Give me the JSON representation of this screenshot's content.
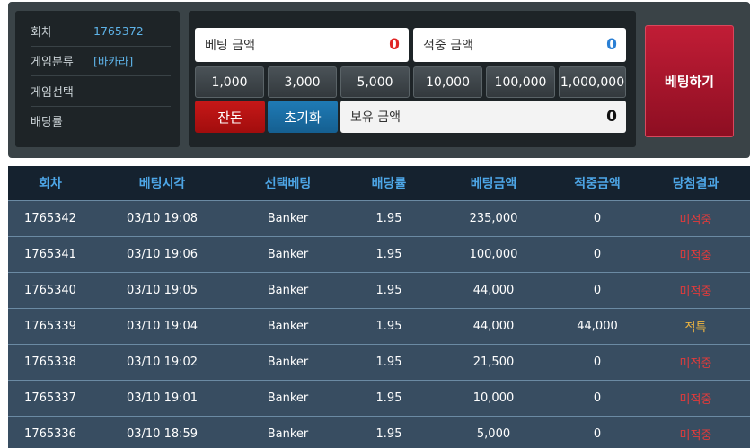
{
  "info": {
    "round_label": "회차",
    "round_value": "1765372",
    "category_label": "게임분류",
    "category_value": "[바카라]",
    "selection_label": "게임선택",
    "selection_value": "",
    "odds_label": "배당률",
    "odds_value": ""
  },
  "bet": {
    "amount_label": "베팅 금액",
    "amount_value": "0",
    "win_label": "적중 금액",
    "win_value": "0",
    "chips": [
      "1,000",
      "3,000",
      "5,000",
      "10,000",
      "100,000",
      "1,000,000"
    ],
    "allin_label": "잔돈",
    "reset_label": "초기화",
    "balance_label": "보유 금액",
    "balance_value": "0",
    "submit_label": "베팅하기"
  },
  "history": {
    "columns": [
      "회차",
      "베팅시각",
      "선택베팅",
      "배당률",
      "베팅금액",
      "적중금액",
      "당첨결과"
    ],
    "rows": [
      {
        "round": "1765342",
        "time": "03/10 19:08",
        "pick": "Banker",
        "odds": "1.95",
        "bet": "235,000",
        "win": "0",
        "result": "미적중",
        "hit": false
      },
      {
        "round": "1765341",
        "time": "03/10 19:06",
        "pick": "Banker",
        "odds": "1.95",
        "bet": "100,000",
        "win": "0",
        "result": "미적중",
        "hit": false
      },
      {
        "round": "1765340",
        "time": "03/10 19:05",
        "pick": "Banker",
        "odds": "1.95",
        "bet": "44,000",
        "win": "0",
        "result": "미적중",
        "hit": false
      },
      {
        "round": "1765339",
        "time": "03/10 19:04",
        "pick": "Banker",
        "odds": "1.95",
        "bet": "44,000",
        "win": "44,000",
        "result": "적특",
        "hit": true
      },
      {
        "round": "1765338",
        "time": "03/10 19:02",
        "pick": "Banker",
        "odds": "1.95",
        "bet": "21,500",
        "win": "0",
        "result": "미적중",
        "hit": false
      },
      {
        "round": "1765337",
        "time": "03/10 19:01",
        "pick": "Banker",
        "odds": "1.95",
        "bet": "10,000",
        "win": "0",
        "result": "미적중",
        "hit": false
      },
      {
        "round": "1765336",
        "time": "03/10 18:59",
        "pick": "Banker",
        "odds": "1.95",
        "bet": "5,000",
        "win": "0",
        "result": "미적중",
        "hit": false
      }
    ]
  },
  "colors": {
    "panel_bg": "#3a4347",
    "box_bg": "#1e2427",
    "info_value": "#5eb3e8",
    "bet_amount": "#e02424",
    "win_amount": "#2a7fd4",
    "allin_button": "#b31313",
    "reset_button": "#1a6da3",
    "submit_button": "#a3152b",
    "table_header_bg": "#15222f",
    "table_header_text": "#4da6e6",
    "table_row_bg": "#384d61",
    "result_miss": "#e23b3b",
    "result_hit": "#f0b640"
  }
}
